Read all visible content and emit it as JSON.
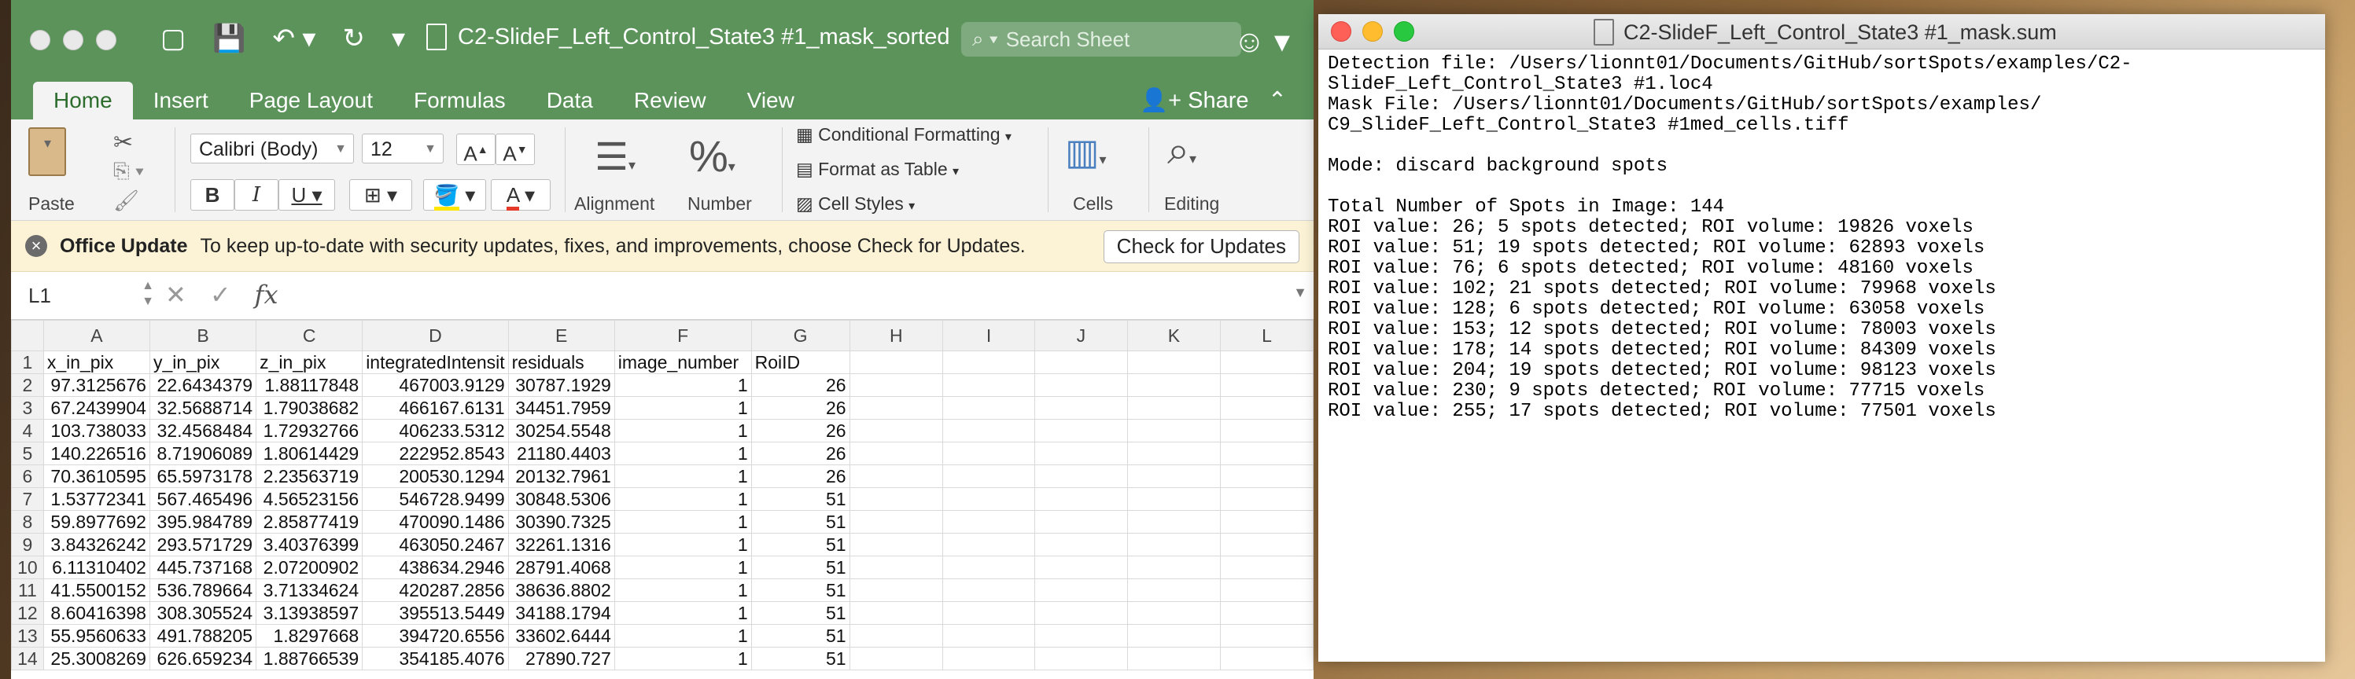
{
  "excel": {
    "window_title": "C2-SlideF_Left_Control_State3 #1_mask_sorted",
    "search_placeholder": "Search Sheet",
    "tabs": [
      "Home",
      "Insert",
      "Page Layout",
      "Formulas",
      "Data",
      "Review",
      "View"
    ],
    "active_tab": "Home",
    "share_label": "Share",
    "ribbon": {
      "paste": "Paste",
      "font_name": "Calibri (Body)",
      "font_size": "12",
      "alignment": "Alignment",
      "number": "Number",
      "conditional_formatting": "Conditional Formatting",
      "format_as_table": "Format as Table",
      "cell_styles": "Cell Styles",
      "cells": "Cells",
      "editing": "Editing"
    },
    "update_bar": {
      "title": "Office Update",
      "message": "To keep up-to-date with security updates, fixes, and improvements, choose Check for Updates.",
      "button": "Check for Updates"
    },
    "name_box": "L1",
    "columns": [
      "A",
      "B",
      "C",
      "D",
      "E",
      "F",
      "G",
      "H",
      "I",
      "J",
      "K",
      "L"
    ],
    "rows": [
      [
        "1",
        "x_in_pix",
        "y_in_pix",
        "z_in_pix",
        "integratedIntensit",
        "residuals",
        "image_number",
        "RoiID",
        "",
        "",
        "",
        "",
        ""
      ],
      [
        "2",
        "97.3125676",
        "22.6434379",
        "1.88117848",
        "467003.9129",
        "30787.1929",
        "1",
        "26",
        "",
        "",
        "",
        "",
        ""
      ],
      [
        "3",
        "67.2439904",
        "32.5688714",
        "1.79038682",
        "466167.6131",
        "34451.7959",
        "1",
        "26",
        "",
        "",
        "",
        "",
        ""
      ],
      [
        "4",
        "103.738033",
        "32.4568484",
        "1.72932766",
        "406233.5312",
        "30254.5548",
        "1",
        "26",
        "",
        "",
        "",
        "",
        ""
      ],
      [
        "5",
        "140.226516",
        "8.71906089",
        "1.80614429",
        "222952.8543",
        "21180.4403",
        "1",
        "26",
        "",
        "",
        "",
        "",
        ""
      ],
      [
        "6",
        "70.3610595",
        "65.5973178",
        "2.23563719",
        "200530.1294",
        "20132.7961",
        "1",
        "26",
        "",
        "",
        "",
        "",
        ""
      ],
      [
        "7",
        "1.53772341",
        "567.465496",
        "4.56523156",
        "546728.9499",
        "30848.5306",
        "1",
        "51",
        "",
        "",
        "",
        "",
        ""
      ],
      [
        "8",
        "59.8977692",
        "395.984789",
        "2.85877419",
        "470090.1486",
        "30390.7325",
        "1",
        "51",
        "",
        "",
        "",
        "",
        ""
      ],
      [
        "9",
        "3.84326242",
        "293.571729",
        "3.40376399",
        "463050.2467",
        "32261.1316",
        "1",
        "51",
        "",
        "",
        "",
        "",
        ""
      ],
      [
        "10",
        "6.11310402",
        "445.737168",
        "2.07200902",
        "438634.2946",
        "28791.4068",
        "1",
        "51",
        "",
        "",
        "",
        "",
        ""
      ],
      [
        "11",
        "41.5500152",
        "536.789664",
        "3.71334624",
        "420287.2856",
        "38636.8802",
        "1",
        "51",
        "",
        "",
        "",
        "",
        ""
      ],
      [
        "12",
        "8.60416398",
        "308.305524",
        "3.13938597",
        "395513.5449",
        "34188.1794",
        "1",
        "51",
        "",
        "",
        "",
        "",
        ""
      ],
      [
        "13",
        "55.9560633",
        "491.788205",
        "1.8297668",
        "394720.6556",
        "33602.6444",
        "1",
        "51",
        "",
        "",
        "",
        "",
        ""
      ],
      [
        "14",
        "25.3008269",
        "626.659234",
        "1.88766539",
        "354185.4076",
        "27890.727",
        "1",
        "51",
        "",
        "",
        "",
        "",
        ""
      ]
    ]
  },
  "textedit": {
    "window_title": "C2-SlideF_Left_Control_State3 #1_mask.sum",
    "lines": [
      "Detection file: /Users/lionnt01/Documents/GitHub/sortSpots/examples/C2-",
      "SlideF_Left_Control_State3 #1.loc4",
      "Mask File: /Users/lionnt01/Documents/GitHub/sortSpots/examples/",
      "C9_SlideF_Left_Control_State3 #1med_cells.tiff",
      "",
      "Mode: discard background spots",
      "",
      "Total Number of Spots in Image: 144",
      "ROI value: 26; 5 spots detected; ROI volume: 19826 voxels",
      "ROI value: 51; 19 spots detected; ROI volume: 62893 voxels",
      "ROI value: 76; 6 spots detected; ROI volume: 48160 voxels",
      "ROI value: 102; 21 spots detected; ROI volume: 79968 voxels",
      "ROI value: 128; 6 spots detected; ROI volume: 63058 voxels",
      "ROI value: 153; 12 spots detected; ROI volume: 78003 voxels",
      "ROI value: 178; 14 spots detected; ROI volume: 84309 voxels",
      "ROI value: 204; 19 spots detected; ROI volume: 98123 voxels",
      "ROI value: 230; 9 spots detected; ROI volume: 77715 voxels",
      "ROI value: 255; 17 spots detected; ROI volume: 77501 voxels"
    ]
  }
}
